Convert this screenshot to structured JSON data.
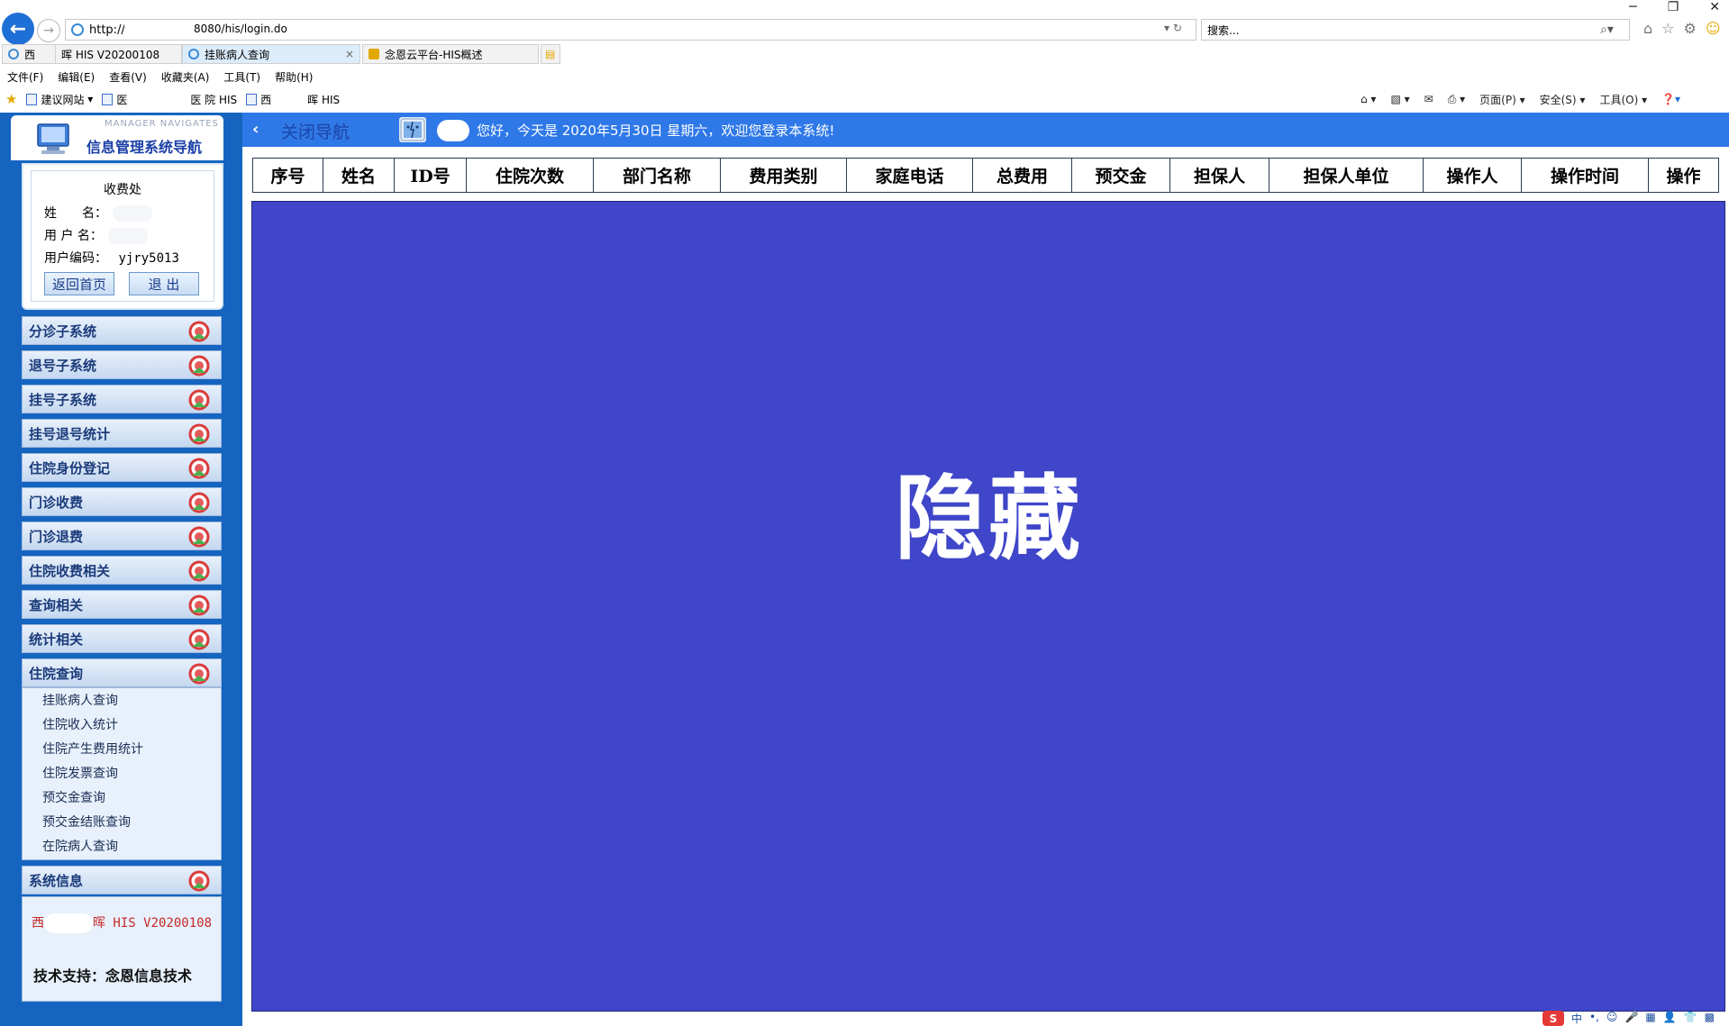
{
  "browser": {
    "url": "http://1",
    "url_tail": "8080/his/login.do",
    "search_placeholder": "搜索...",
    "window_controls": [
      "─",
      "❐",
      "✕"
    ],
    "tabs": [
      {
        "label": "西",
        "active": false
      },
      {
        "label": "晖 HIS V20200108",
        "active": false
      },
      {
        "label": "挂账病人查询",
        "active": true,
        "close": "×"
      },
      {
        "label": "念恩云平台-HIS概述",
        "active": false
      }
    ],
    "menu": [
      "文件(F)",
      "编辑(E)",
      "查看(V)",
      "收藏夹(A)",
      "工具(T)",
      "帮助(H)"
    ],
    "favorites": [
      "建议网站",
      "医",
      "医 院 HIS",
      "西",
      "晖 HIS"
    ],
    "commands": [
      "页面(P)",
      "安全(S)",
      "工具(O)"
    ]
  },
  "sidebar": {
    "header_sub": "MANAGER NAVIGATES",
    "header_title": "信息管理系统导航",
    "user_panel": {
      "title": "收费处",
      "name_label": "姓　　名：",
      "username_label": "用 户 名：",
      "usercode_label": "用户编码：",
      "usercode_value": "yjry5013",
      "home_button": "返回首页",
      "logout_button": "退 出"
    },
    "menu_items": [
      "分诊子系统",
      "退号子系统",
      "挂号子系统",
      "挂号退号统计",
      "住院身份登记",
      "门诊收费",
      "门诊退费",
      "住院收费相关",
      "查询相关",
      "统计相关",
      "住院查询"
    ],
    "submenu": [
      "挂账病人查询",
      "住院收入统计",
      "住院产生费用统计",
      "住院发票查询",
      "预交金查询",
      "预交金结账查询",
      "在院病人查询"
    ],
    "sysinfo": {
      "title": "系统信息",
      "line1_prefix": "西",
      "line1_suffix": "晖 HIS V20200108",
      "support": "技术支持：念恩信息技术"
    }
  },
  "topbar": {
    "close_nav": "关闭导航",
    "greeting": "您好，今天是 2020年5月30日 星期六，欢迎您登录本系统!"
  },
  "table": {
    "columns": [
      "序号",
      "姓名",
      "ID号",
      "住院次数",
      "部门名称",
      "费用类别",
      "家庭电话",
      "总费用",
      "预交金",
      "担保人",
      "担保人单位",
      "操作人",
      "操作时间",
      "操作"
    ]
  },
  "content": {
    "overlay_text": "隐藏"
  },
  "statusbar": {
    "ime": "S",
    "items": [
      "中",
      "•,",
      "☺",
      "🎤",
      "▦",
      "👤",
      "👕",
      "▩"
    ]
  },
  "colors": {
    "sidebar_bg": "#1565c0",
    "topbar_bg": "#2e78e8",
    "content_bg": "#3f46c9"
  }
}
